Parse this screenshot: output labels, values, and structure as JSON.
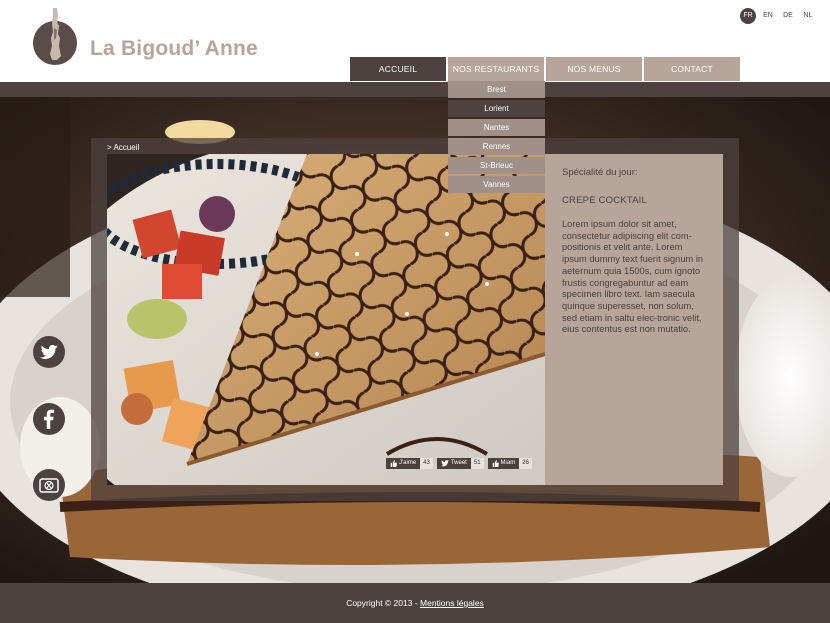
{
  "brand": {
    "name": "La Bigoud’ Anne"
  },
  "languages": [
    "FR",
    "EN",
    "DE",
    "NL"
  ],
  "nav": {
    "home": "ACCUEIL",
    "restaurants": "NOS RESTAURANTS",
    "menus": "NOS MENUS",
    "contact": "CONTACT"
  },
  "dropdown": [
    "Brest",
    "Lorient",
    "Nantes",
    "Rennes",
    "St-Brieuc",
    "Vannes"
  ],
  "breadcrumb": "> Accueil",
  "special": {
    "label": "Spécialité du jour:",
    "title": "CREPE COCKTAIL",
    "text": "Lorem ipsum dolor sit amet, consectetur adipiscing elit com-positionis et velit ante. Lorem ipsum dummy text fuerit signum in aeternum quia 1500s, cum ignoto frustis congregabuntur ad eam specimen libro text. Iam saecula quinque superesset, non solum, sed etiam in saltu elec-tronic velit, eius contentus est non mutatio."
  },
  "shares": {
    "like": {
      "label": "J'aime",
      "count": "43"
    },
    "tweet": {
      "label": "Tweet",
      "count": "51"
    },
    "miam": {
      "label": "Miam",
      "count": "26"
    }
  },
  "social_icons": [
    "twitter-icon",
    "facebook-icon",
    "restaurant-icon"
  ],
  "footer": {
    "copyright": "Copyright © 2013 - ",
    "legal": "Mentions légales"
  },
  "colors": {
    "dark": "#4d423f",
    "taupe": "#b7a59a"
  }
}
